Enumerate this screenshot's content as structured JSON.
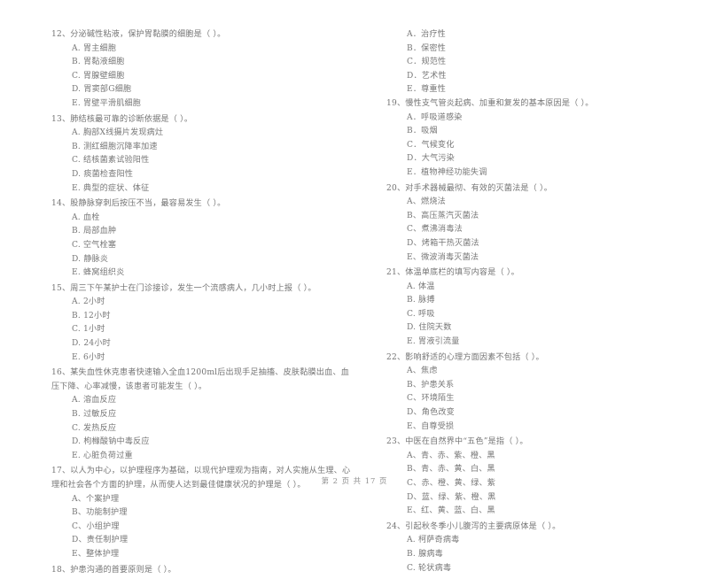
{
  "document": {
    "type": "scanned-exam-paper",
    "footer": "第 2 页  共 17 页"
  },
  "left_column": {
    "questions": [
      {
        "stem": "12、分泌碱性粘液，保护胃黏膜的细胞是（      ）。",
        "options": [
          "A. 胃主细胞",
          "B. 胃黏液细胞",
          "C. 胃腺壁细胞",
          "D. 胃窦部G细胞",
          "E. 胃壁平滑肌细胞"
        ]
      },
      {
        "stem": "13、肺结核最可靠的诊断依据是（      ）。",
        "options": [
          "A. 胸部X线摄片发现病灶",
          "B. 测红细胞沉降率加速",
          "C. 结核菌素试验阳性",
          "D. 痰菌检查阳性",
          "E. 典型的症状、体征"
        ]
      },
      {
        "stem": "14、股静脉穿刺后按压不当，最容易发生（      ）。",
        "options": [
          "A. 血栓",
          "B. 局部血肿",
          "C. 空气栓塞",
          "D. 静脉炎",
          "E. 蜂窝组织炎"
        ]
      },
      {
        "stem": "15、周三下午某护士在门诊接诊，发生一个流感病人，几小时上报（      ）。",
        "options": [
          "A. 2小时",
          "B. 12小时",
          "C. 1小时",
          "D. 24小时",
          "E. 6小时"
        ]
      },
      {
        "stem": "16、某失血性休克患者快速输入全血1200ml后出现手足抽搐、皮肤黏膜出血、血压下降、心率减慢，该患者可能发生（      ）。",
        "options": [
          "A. 溶血反应",
          "B. 过敏反应",
          "C. 发热反应",
          "D. 枸橼酸钠中毒反应",
          "E. 心脏负荷过重"
        ]
      },
      {
        "stem": "17、以人为中心，以护理程序为基础，以现代护理观为指南，对人实施从生理、心理和社会各个方面的护理，从而使人达到最佳健康状况的护理是（      ）。",
        "options": [
          "A、个案护理",
          "B、功能制护理",
          "C、小组护理",
          "D、责任制护理",
          "E、整体护理"
        ]
      },
      {
        "stem": "18、护患沟通的首要原则是（      ）。",
        "options": []
      }
    ]
  },
  "right_column": {
    "continued_options": [
      "A．治疗性",
      "B．保密性",
      "C．规范性",
      "D．艺术性",
      "E．尊重性"
    ],
    "questions": [
      {
        "stem": "19、慢性支气管炎起病、加重和复发的基本原因是（      ）。",
        "options": [
          "A．呼吸道感染",
          "B．吸烟",
          "C．气候变化",
          "D．大气污染",
          "E．植物神经功能失调"
        ]
      },
      {
        "stem": "20、对手术器械最彻、有效的灭菌法是（      ）。",
        "options": [
          "A、燃烧法",
          "B、高压蒸汽灭菌法",
          "C、煮沸消毒法",
          "D、烤箱干热灭菌法",
          "E、微波消毒灭菌法"
        ]
      },
      {
        "stem": "21、体温单底栏的填写内容是（      ）。",
        "options": [
          "A. 体温",
          "B. 脉搏",
          "C. 呼吸",
          "D. 住院天数",
          "E. 胃液引流量"
        ]
      },
      {
        "stem": "22、影响舒适的心理方面因素不包括（      ）。",
        "options": [
          "A、焦虑",
          "B、护患关系",
          "C、环境陌生",
          "D、角色改变",
          "E、自尊受损"
        ]
      },
      {
        "stem": "23、中医在自然界中“五色”是指（      ）。",
        "options": [
          "A、青、赤、紫、橙、黑",
          "B、青、赤、黄、白、黑",
          "C、赤、橙、黄、绿、紫",
          "D、蓝、绿、紫、橙、黑",
          "E、红、黄、蓝、白、黑"
        ]
      },
      {
        "stem": "24、引起秋冬季小儿腹泻的主要病原体是（      ）。",
        "options": [
          "A. 柯萨奇病毒",
          "B. 腺病毒",
          "C. 轮状病毒"
        ]
      }
    ]
  }
}
